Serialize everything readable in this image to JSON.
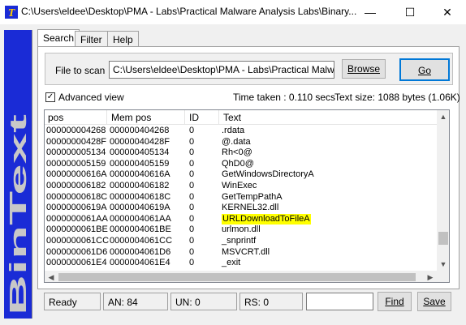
{
  "window": {
    "title": "C:\\Users\\eldee\\Desktop\\PMA - Labs\\Practical Malware Analysis Labs\\Binary...",
    "minimize_glyph": "—",
    "maximize_glyph": "☐",
    "close_glyph": "✕"
  },
  "sidebar": {
    "brand_text": "BinText",
    "color": "#1a2bd6",
    "text_color": "#c8c8c8"
  },
  "tabs": [
    {
      "label": "Search",
      "active": true
    },
    {
      "label": "Filter",
      "active": false
    },
    {
      "label": "Help",
      "active": false
    }
  ],
  "scan": {
    "label": "File to scan",
    "path_value": "C:\\Users\\eldee\\Desktop\\PMA - Labs\\Practical Malware A",
    "browse_label": "Browse",
    "go_label": "Go"
  },
  "options": {
    "advanced_view_label": "Advanced view",
    "advanced_view_checked": true,
    "check_glyph": "✓",
    "time_taken": "Time taken : 0.110 secs",
    "text_size": "Text size: 1088 bytes (1.06K)"
  },
  "table": {
    "columns": [
      "pos",
      "Mem pos",
      "ID",
      "Text"
    ],
    "rows": [
      [
        "000000004268",
        "000000404268",
        "0",
        ".rdata"
      ],
      [
        "00000000428F",
        "00000040428F",
        "0",
        "@.data"
      ],
      [
        "000000005134",
        "000000405134",
        "0",
        "Rh<0@"
      ],
      [
        "000000005159",
        "000000405159",
        "0",
        "QhD0@"
      ],
      [
        "00000000616A",
        "00000040616A",
        "0",
        "GetWindowsDirectoryA"
      ],
      [
        "000000006182",
        "000000406182",
        "0",
        "WinExec"
      ],
      [
        "00000000618C",
        "00000040618C",
        "0",
        "GetTempPathA"
      ],
      [
        "00000000619A",
        "00000040619A",
        "0",
        "KERNEL32.dll"
      ],
      [
        "0000000061AA",
        "0000004061AA",
        "0",
        "URLDownloadToFileA"
      ],
      [
        "0000000061BE",
        "0000004061BE",
        "0",
        "urlmon.dll"
      ],
      [
        "0000000061CC",
        "0000004061CC",
        "0",
        "_snprintf"
      ],
      [
        "0000000061D6",
        "0000004061D6",
        "0",
        "MSVCRT.dll"
      ],
      [
        "0000000061E4",
        "0000004061E4",
        "0",
        "_exit"
      ]
    ],
    "highlighted_text": "URLDownloadToFileA",
    "highlight_color": "#ffff00",
    "scroll_up": "▲",
    "scroll_down": "▼",
    "scroll_left": "◀",
    "scroll_right": "▶"
  },
  "statusbar": {
    "ready": "Ready",
    "an": "AN: 84",
    "un": "UN: 0",
    "rs": "RS: 0",
    "find_value": "",
    "find_label": "Find",
    "save_label": "Save"
  }
}
